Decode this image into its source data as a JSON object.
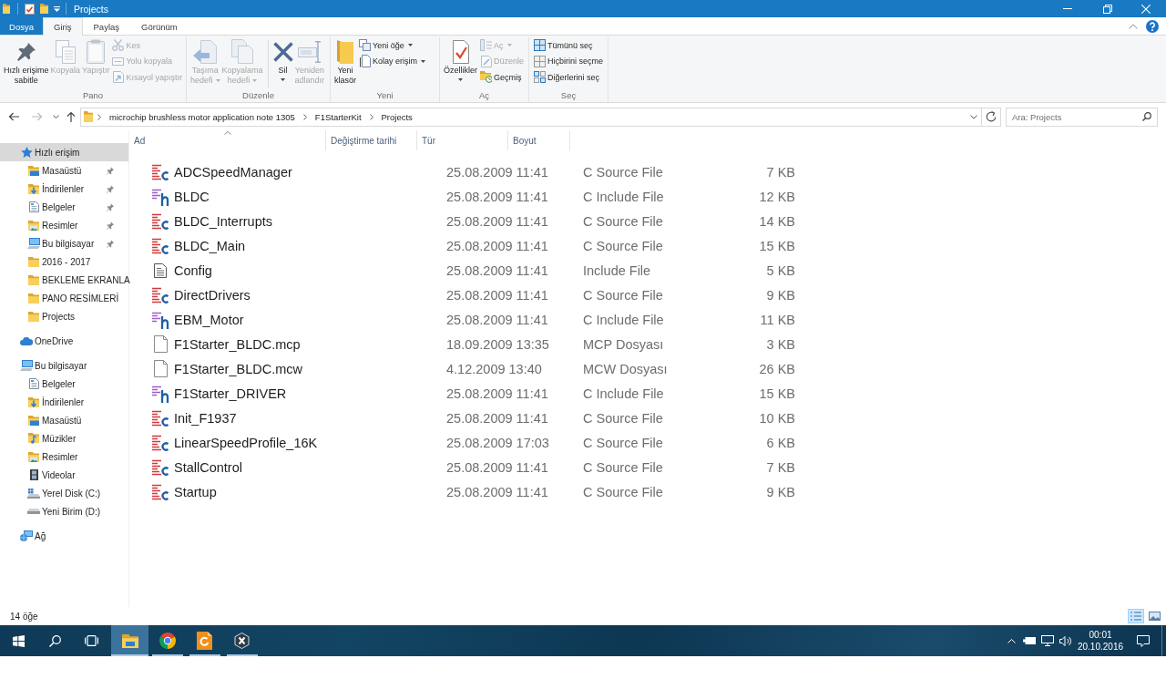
{
  "window": {
    "title": "Projects"
  },
  "ribbon": {
    "tabs": [
      {
        "label": "Dosya",
        "kind": "file_menu",
        "selected": false
      },
      {
        "label": "Giriş",
        "kind": "tab",
        "selected": true
      },
      {
        "label": "Paylaş",
        "kind": "tab",
        "selected": false
      },
      {
        "label": "Görünüm",
        "kind": "tab",
        "selected": false
      }
    ],
    "groups": [
      {
        "label": "Pano",
        "commands": [
          {
            "kind": "large",
            "label": "Hızlı erişime\nsabitle",
            "disabled": false,
            "menu": false
          },
          {
            "kind": "large",
            "label": "Kopyala",
            "disabled": true,
            "menu": false
          },
          {
            "kind": "large",
            "label": "Yapıştır",
            "disabled": true,
            "menu": false
          },
          {
            "kind": "small",
            "label": "Kes",
            "disabled": true,
            "menu": false
          },
          {
            "kind": "small",
            "label": "Yolu kopyala",
            "disabled": true,
            "menu": false
          },
          {
            "kind": "small",
            "label": "Kısayol yapıştır",
            "disabled": true,
            "menu": false
          }
        ]
      },
      {
        "label": "Düzenle",
        "commands": [
          {
            "kind": "large",
            "label": "Taşıma\nhedefi",
            "disabled": true,
            "menu": true
          },
          {
            "kind": "large",
            "label": "Kopyalama\nhedefi",
            "disabled": true,
            "menu": true
          },
          {
            "kind": "separator"
          },
          {
            "kind": "large",
            "label": "Sil",
            "disabled": false,
            "menu": true
          },
          {
            "kind": "large",
            "label": "Yeniden\nadlandır",
            "disabled": true,
            "menu": false
          }
        ]
      },
      {
        "label": "Yeni",
        "commands": [
          {
            "kind": "large",
            "label": "Yeni\nklasör",
            "disabled": false,
            "menu": false
          },
          {
            "kind": "small",
            "label": "Yeni öğe",
            "disabled": false,
            "menu": true
          },
          {
            "kind": "small",
            "label": "Kolay erişim",
            "disabled": false,
            "menu": true
          }
        ]
      },
      {
        "label": "Aç",
        "commands": [
          {
            "kind": "large",
            "label": "Özellikler",
            "disabled": false,
            "menu": true
          },
          {
            "kind": "small",
            "label": "Aç",
            "disabled": true,
            "menu": true
          },
          {
            "kind": "small",
            "label": "Düzenle",
            "disabled": true,
            "menu": false
          },
          {
            "kind": "small",
            "label": "Geçmiş",
            "disabled": false,
            "menu": false
          }
        ]
      },
      {
        "label": "Seç",
        "commands": [
          {
            "kind": "small",
            "label": "Tümünü seç",
            "disabled": false,
            "menu": false
          },
          {
            "kind": "small",
            "label": "Hiçbirini seçme",
            "disabled": false,
            "menu": false
          },
          {
            "kind": "small",
            "label": "Diğerlerini seç",
            "disabled": false,
            "menu": false
          }
        ]
      }
    ]
  },
  "address_bar": {
    "back": {
      "disabled": false
    },
    "forward": {
      "disabled": true
    },
    "path": [
      "microchip brushless motor application note 1305",
      "F1StarterKit",
      "Projects"
    ]
  },
  "search": {
    "placeholder": "Ara: Projects"
  },
  "navigation_pane": {
    "items": [
      {
        "label": "Hızlı erişim",
        "kind": "quick_access",
        "selected": true,
        "pinned": false,
        "children": [
          {
            "label": "Masaüstü",
            "kind": "desktop",
            "selected": false,
            "pinned": true
          },
          {
            "label": "İndirilenler",
            "kind": "downloads",
            "selected": false,
            "pinned": true
          },
          {
            "label": "Belgeler",
            "kind": "documents",
            "selected": false,
            "pinned": true
          },
          {
            "label": "Resimler",
            "kind": "pictures",
            "selected": false,
            "pinned": true
          },
          {
            "label": "Bu bilgisayar",
            "kind": "computer",
            "selected": false,
            "pinned": true
          },
          {
            "label": "2016 - 2017",
            "kind": "folder",
            "selected": false,
            "pinned": false
          },
          {
            "label": "BEKLEME EKRANLA",
            "kind": "folder",
            "selected": false,
            "pinned": false
          },
          {
            "label": "PANO RESİMLERİ",
            "kind": "folder",
            "selected": false,
            "pinned": false
          },
          {
            "label": "Projects",
            "kind": "folder",
            "selected": false,
            "pinned": false
          }
        ]
      },
      {
        "label": "OneDrive",
        "kind": "cloud",
        "selected": false,
        "pinned": false
      },
      {
        "label": "Bu bilgisayar",
        "kind": "computer",
        "selected": false,
        "pinned": false,
        "children": [
          {
            "label": "Belgeler",
            "kind": "documents",
            "selected": false,
            "pinned": false
          },
          {
            "label": "İndirilenler",
            "kind": "downloads",
            "selected": false,
            "pinned": false
          },
          {
            "label": "Masaüstü",
            "kind": "desktop",
            "selected": false,
            "pinned": false
          },
          {
            "label": "Müzikler",
            "kind": "music",
            "selected": false,
            "pinned": false
          },
          {
            "label": "Resimler",
            "kind": "pictures",
            "selected": false,
            "pinned": false
          },
          {
            "label": "Videolar",
            "kind": "videos",
            "selected": false,
            "pinned": false
          },
          {
            "label": "Yerel Disk (C:)",
            "kind": "system_drive",
            "selected": false,
            "pinned": false
          },
          {
            "label": "Yeni Birim (D:)",
            "kind": "drive",
            "selected": false,
            "pinned": false
          }
        ]
      },
      {
        "label": "Ağ",
        "kind": "network",
        "selected": false,
        "pinned": false
      }
    ]
  },
  "file_list": {
    "columns": [
      {
        "label": "Ad",
        "sorted": true
      },
      {
        "label": "Değiştirme tarihi",
        "sorted": false
      },
      {
        "label": "Tür",
        "sorted": false
      },
      {
        "label": "Boyut",
        "sorted": false
      }
    ],
    "rows": [
      {
        "kind": "c_source",
        "name": "ADCSpeedManager",
        "modified": "25.08.2009 11:41",
        "type": "C Source File",
        "size": "7 KB"
      },
      {
        "kind": "c_header",
        "name": "BLDC",
        "modified": "25.08.2009 11:41",
        "type": "C Include File",
        "size": "12 KB"
      },
      {
        "kind": "c_source",
        "name": "BLDC_Interrupts",
        "modified": "25.08.2009 11:41",
        "type": "C Source File",
        "size": "14 KB"
      },
      {
        "kind": "c_source",
        "name": "BLDC_Main",
        "modified": "25.08.2009 11:41",
        "type": "C Source File",
        "size": "15 KB"
      },
      {
        "kind": "text",
        "name": "Config",
        "modified": "25.08.2009 11:41",
        "type": "Include File",
        "size": "5 KB"
      },
      {
        "kind": "c_source",
        "name": "DirectDrivers",
        "modified": "25.08.2009 11:41",
        "type": "C Source File",
        "size": "9 KB"
      },
      {
        "kind": "c_header",
        "name": "EBM_Motor",
        "modified": "25.08.2009 11:41",
        "type": "C Include File",
        "size": "11 KB"
      },
      {
        "kind": "blank",
        "name": "F1Starter_BLDC.mcp",
        "modified": "18.09.2009 13:35",
        "type": "MCP Dosyası",
        "size": "3 KB"
      },
      {
        "kind": "blank",
        "name": "F1Starter_BLDC.mcw",
        "modified": "4.12.2009 13:40",
        "type": "MCW Dosyası",
        "size": "26 KB"
      },
      {
        "kind": "c_header",
        "name": "F1Starter_DRIVER",
        "modified": "25.08.2009 11:41",
        "type": "C Include File",
        "size": "15 KB"
      },
      {
        "kind": "c_source",
        "name": "Init_F1937",
        "modified": "25.08.2009 11:41",
        "type": "C Source File",
        "size": "10 KB"
      },
      {
        "kind": "c_source",
        "name": "LinearSpeedProfile_16K",
        "modified": "25.08.2009 17:03",
        "type": "C Source File",
        "size": "6 KB"
      },
      {
        "kind": "c_source",
        "name": "StallControl",
        "modified": "25.08.2009 11:41",
        "type": "C Source File",
        "size": "7 KB"
      },
      {
        "kind": "c_source",
        "name": "Startup",
        "modified": "25.08.2009 11:41",
        "type": "C Source File",
        "size": "9 KB"
      }
    ]
  },
  "status_bar": {
    "item_count": "14 öğe",
    "view_buttons": [
      {
        "selected": true
      },
      {
        "selected": false
      }
    ]
  },
  "taskbar": {
    "apps": [
      {
        "running": true,
        "active": true
      },
      {
        "running": true,
        "active": false
      },
      {
        "running": true,
        "active": false
      },
      {
        "running": true,
        "active": false
      }
    ],
    "clock": {
      "time": "00:01",
      "date": "20.10.2016"
    }
  }
}
